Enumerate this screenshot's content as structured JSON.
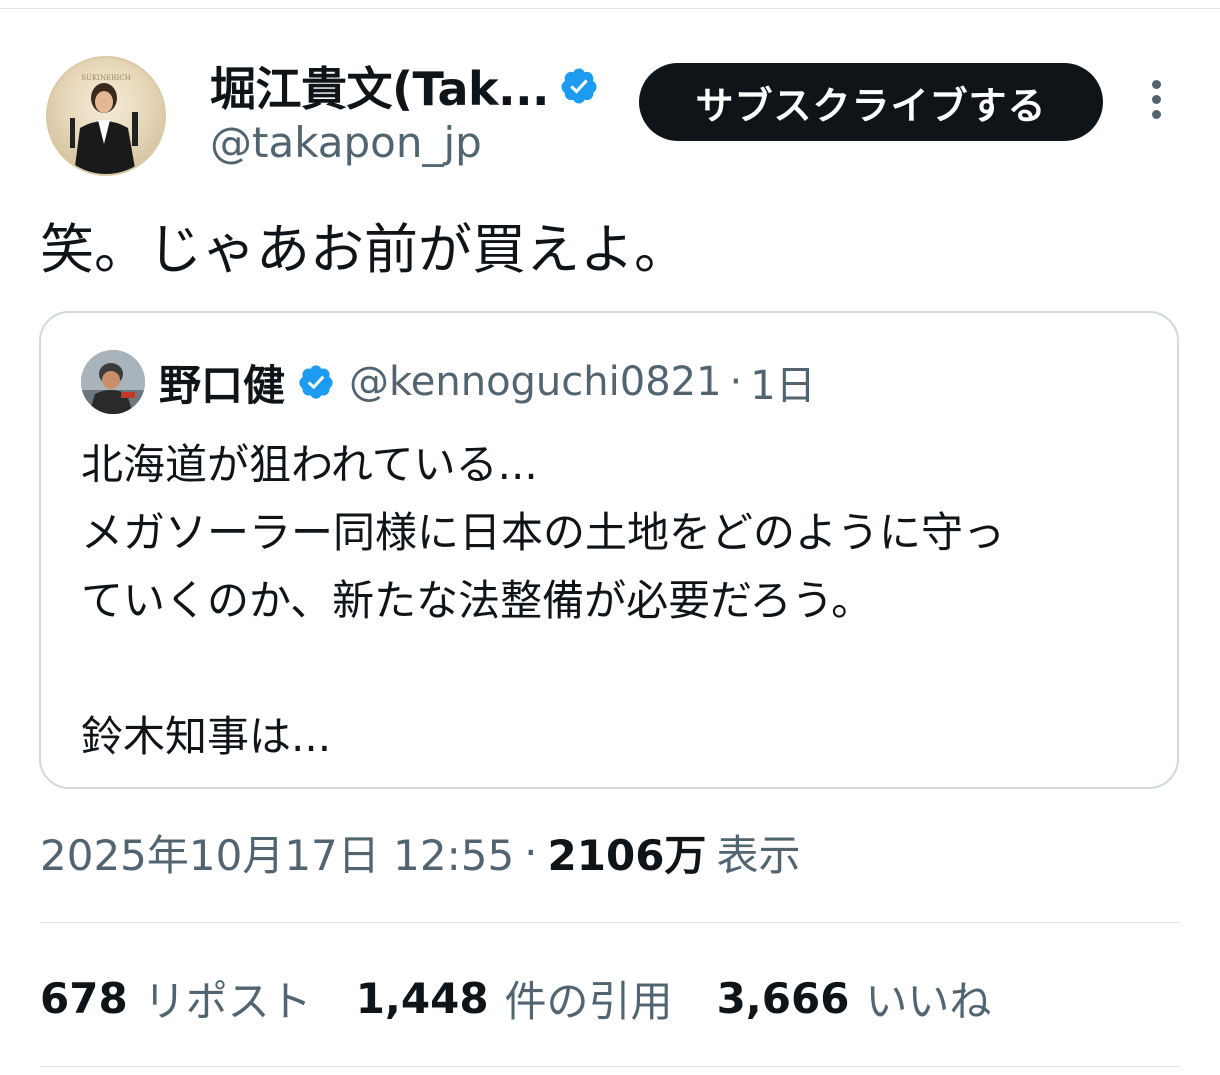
{
  "author": {
    "display_name": "堀江貴文(Tak...",
    "handle": "@takapon_jp",
    "avatar_banner_text": "SUKINERICH",
    "verified": true
  },
  "actions": {
    "subscribe_label": "サブスクライブする",
    "more_icon": "more-vertical-icon"
  },
  "tweet": {
    "text": "笑。じゃあお前が買えよ。"
  },
  "quoted_tweet": {
    "display_name": "野口健",
    "handle": "@kennoguchi0821",
    "separator": "·",
    "time": "1日",
    "lines": [
      "北海道が狙われている...",
      "メガソーラー同様に日本の土地をどのように守っ",
      "ていくのか、新たな法整備が必要だろう。",
      "",
      "鈴木知事は..."
    ]
  },
  "meta": {
    "datetime": "2025年10月17日 12:55",
    "separator": "·",
    "views_count": "2106万",
    "views_label": "表示"
  },
  "stats": {
    "reposts": {
      "count": "678",
      "label": "リポスト"
    },
    "quotes": {
      "count": "1,448",
      "label": "件の引用"
    },
    "likes": {
      "count": "3,666",
      "label": "いいね"
    }
  },
  "colors": {
    "text_primary": "#0f1419",
    "text_secondary": "#536471",
    "verified_blue": "#1d9bf0",
    "border": "#cfd9de",
    "button_bg": "#0f1419"
  }
}
